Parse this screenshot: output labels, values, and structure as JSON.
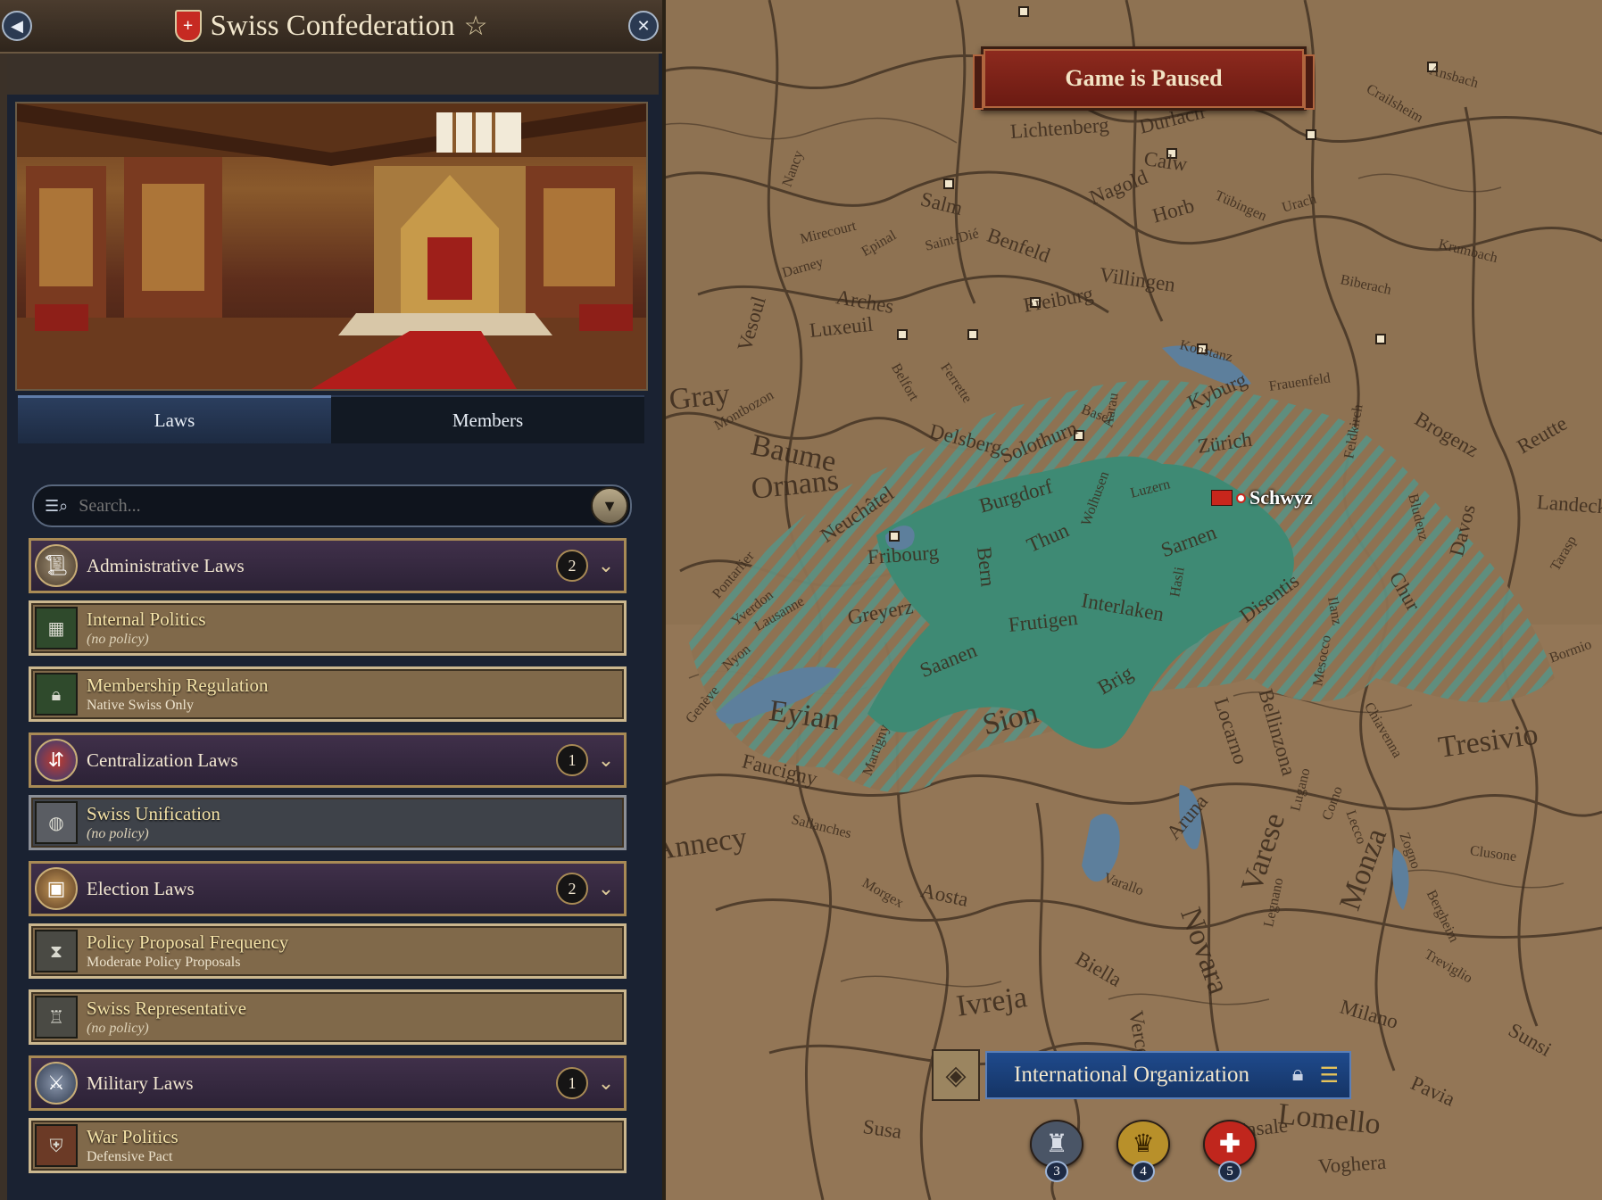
{
  "panel": {
    "title": "Swiss Confederation",
    "tabs": [
      {
        "label": "Laws",
        "active": true
      },
      {
        "label": "Members",
        "active": false
      }
    ],
    "search": {
      "placeholder": "Search...",
      "value": ""
    },
    "categories": [
      {
        "label": "Administrative Laws",
        "count": "2",
        "icon": "scroll-icon",
        "laws": [
          {
            "name": "Internal Politics",
            "policy": "(no policy)",
            "icon": "map-icon"
          },
          {
            "name": "Membership Regulation",
            "policy": "Native Swiss Only",
            "icon": "lock-icon"
          }
        ]
      },
      {
        "label": "Centralization Laws",
        "count": "1",
        "icon": "centralization-icon",
        "laws": [
          {
            "name": "Swiss Unification",
            "policy": "(no policy)",
            "icon": "globe-icon"
          }
        ]
      },
      {
        "label": "Election Laws",
        "count": "2",
        "icon": "ballot-box-icon",
        "laws": [
          {
            "name": "Policy Proposal Frequency",
            "policy": "Moderate Policy Proposals",
            "icon": "hourglass-icon"
          },
          {
            "name": "Swiss Representative",
            "policy": "(no policy)",
            "icon": "throne-icon"
          }
        ]
      },
      {
        "label": "Military Laws",
        "count": "1",
        "icon": "crossed-swords-icon",
        "laws": [
          {
            "name": "War Politics",
            "policy": "Defensive Pact",
            "icon": "shield-icon"
          }
        ]
      }
    ]
  },
  "map": {
    "banner": "Game is Paused",
    "capital_label": "Schwyz",
    "intl_org": {
      "title": "International Organization",
      "members": [
        {
          "number": "3",
          "icon": "eagle-icon",
          "color": "#4a5566"
        },
        {
          "number": "4",
          "icon": "crown-icon",
          "color": "#b8902a"
        },
        {
          "number": "5",
          "icon": "swiss-cross-icon",
          "color": "#c0261d"
        }
      ]
    },
    "labels": {
      "large": [
        "Baume",
        "Ornans",
        "Sion",
        "Eyian",
        "Gray",
        "Tresivio",
        "Novara",
        "Annecy",
        "Ivreja",
        "Varese",
        "Monza",
        "Lomello"
      ],
      "medium": [
        "Bern",
        "Thun",
        "Sarnen",
        "Interlaken",
        "Zürich",
        "Kyburg",
        "Saanen",
        "Frutigen",
        "Greyerz",
        "Fribourg",
        "Neuchâtel",
        "Burgdorf",
        "Solothurn",
        "Delsberg",
        "Luxeuil",
        "Vesoul",
        "Arches",
        "Salm",
        "Nagold",
        "Horb",
        "Calw",
        "Durlach",
        "Chur",
        "Davos",
        "Disentis",
        "Locarno",
        "Bellinzona",
        "Aosta",
        "Biella",
        "Vercelli",
        "Milano",
        "Pavia",
        "Casale",
        "Susa",
        "Voghera",
        "Aruna",
        "Faucigny",
        "Freiburg",
        "Villingen",
        "Benfeld",
        "Lichtenberg",
        "Brogenz",
        "Landeck",
        "Reutte",
        "Sunsi",
        "Brig"
      ],
      "small": [
        "Luzern",
        "Basel",
        "Konstanz",
        "Frauenfeld",
        "Ansbach",
        "Crailsheim",
        "Urach",
        "Tübingen",
        "Krumbach",
        "Biberach",
        "Saint-Dié",
        "Epinal",
        "Nancy",
        "Mirecourt",
        "Darney",
        "Belfort",
        "Ferrette",
        "Montbozon",
        "Pontarlier",
        "Yverdon",
        "Lausanne",
        "Nyon",
        "Genève",
        "Sallanches",
        "Martigny",
        "Morgex",
        "Varallo",
        "Legnano",
        "Treviglio",
        "Bergheim",
        "Clusone",
        "Bormio",
        "Tarasp",
        "Mesocco",
        "Ilanz",
        "Lugano",
        "Como",
        "Lecco",
        "Chiavenna",
        "Zogno",
        "Feldkirch",
        "Bludenz",
        "Wolhusen",
        "Hasli",
        "Aarau"
      ]
    }
  }
}
